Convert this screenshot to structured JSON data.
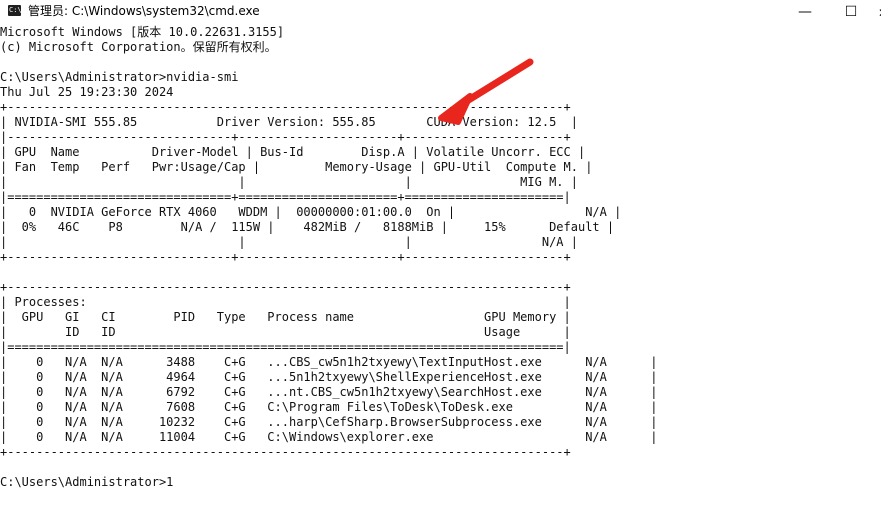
{
  "window": {
    "title": "管理员: C:\\Windows\\system32\\cmd.exe",
    "icon_text": "C:\\"
  },
  "controls": {
    "minimize": "—",
    "maximize": "☐"
  },
  "console": {
    "lines": [
      "Microsoft Windows [版本 10.0.22631.3155]",
      "(c) Microsoft Corporation。保留所有权利。",
      "",
      "C:\\Users\\Administrator>nvidia-smi",
      "Thu Jul 25 19:23:30 2024",
      "+-----------------------------------------------------------------------------+",
      "| NVIDIA-SMI 555.85           Driver Version: 555.85       CUDA Version: 12.5  |",
      "|-------------------------------+----------------------+----------------------+",
      "| GPU  Name          Driver-Model | Bus-Id        Disp.A | Volatile Uncorr. ECC |",
      "| Fan  Temp   Perf   Pwr:Usage/Cap |         Memory-Usage | GPU-Util  Compute M. |",
      "|                                |                      |               MIG M. |",
      "|===============================+======================+======================|",
      "|   0  NVIDIA GeForce RTX 4060   WDDM |  00000000:01:00.0  On |                  N/A |",
      "|  0%   46C    P8        N/A /  115W |    482MiB /   8188MiB |     15%      Default |",
      "|                                |                      |                  N/A |",
      "+-------------------------------+----------------------+----------------------+",
      "",
      "+-----------------------------------------------------------------------------+",
      "| Processes:                                                                  |",
      "|  GPU   GI   CI        PID   Type   Process name                  GPU Memory |",
      "|        ID   ID                                                   Usage      |",
      "|=============================================================================|",
      "|    0   N/A  N/A      3488    C+G   ...CBS_cw5n1h2txyewy\\TextInputHost.exe      N/A      |",
      "|    0   N/A  N/A      4964    C+G   ...5n1h2txyewy\\ShellExperienceHost.exe      N/A      |",
      "|    0   N/A  N/A      6792    C+G   ...nt.CBS_cw5n1h2txyewy\\SearchHost.exe      N/A      |",
      "|    0   N/A  N/A      7608    C+G   C:\\Program Files\\ToDesk\\ToDesk.exe          N/A      |",
      "|    0   N/A  N/A     10232    C+G   ...harp\\CefSharp.BrowserSubprocess.exe      N/A      |",
      "|    0   N/A  N/A     11004    C+G   C:\\Windows\\explorer.exe                     N/A      |",
      "+-----------------------------------------------------------------------------+",
      "",
      "C:\\Users\\Administrator>1"
    ]
  },
  "annotation": {
    "arrow_color": "#e8261d",
    "icon": "red-arrow-pointing-at-driver-version"
  }
}
